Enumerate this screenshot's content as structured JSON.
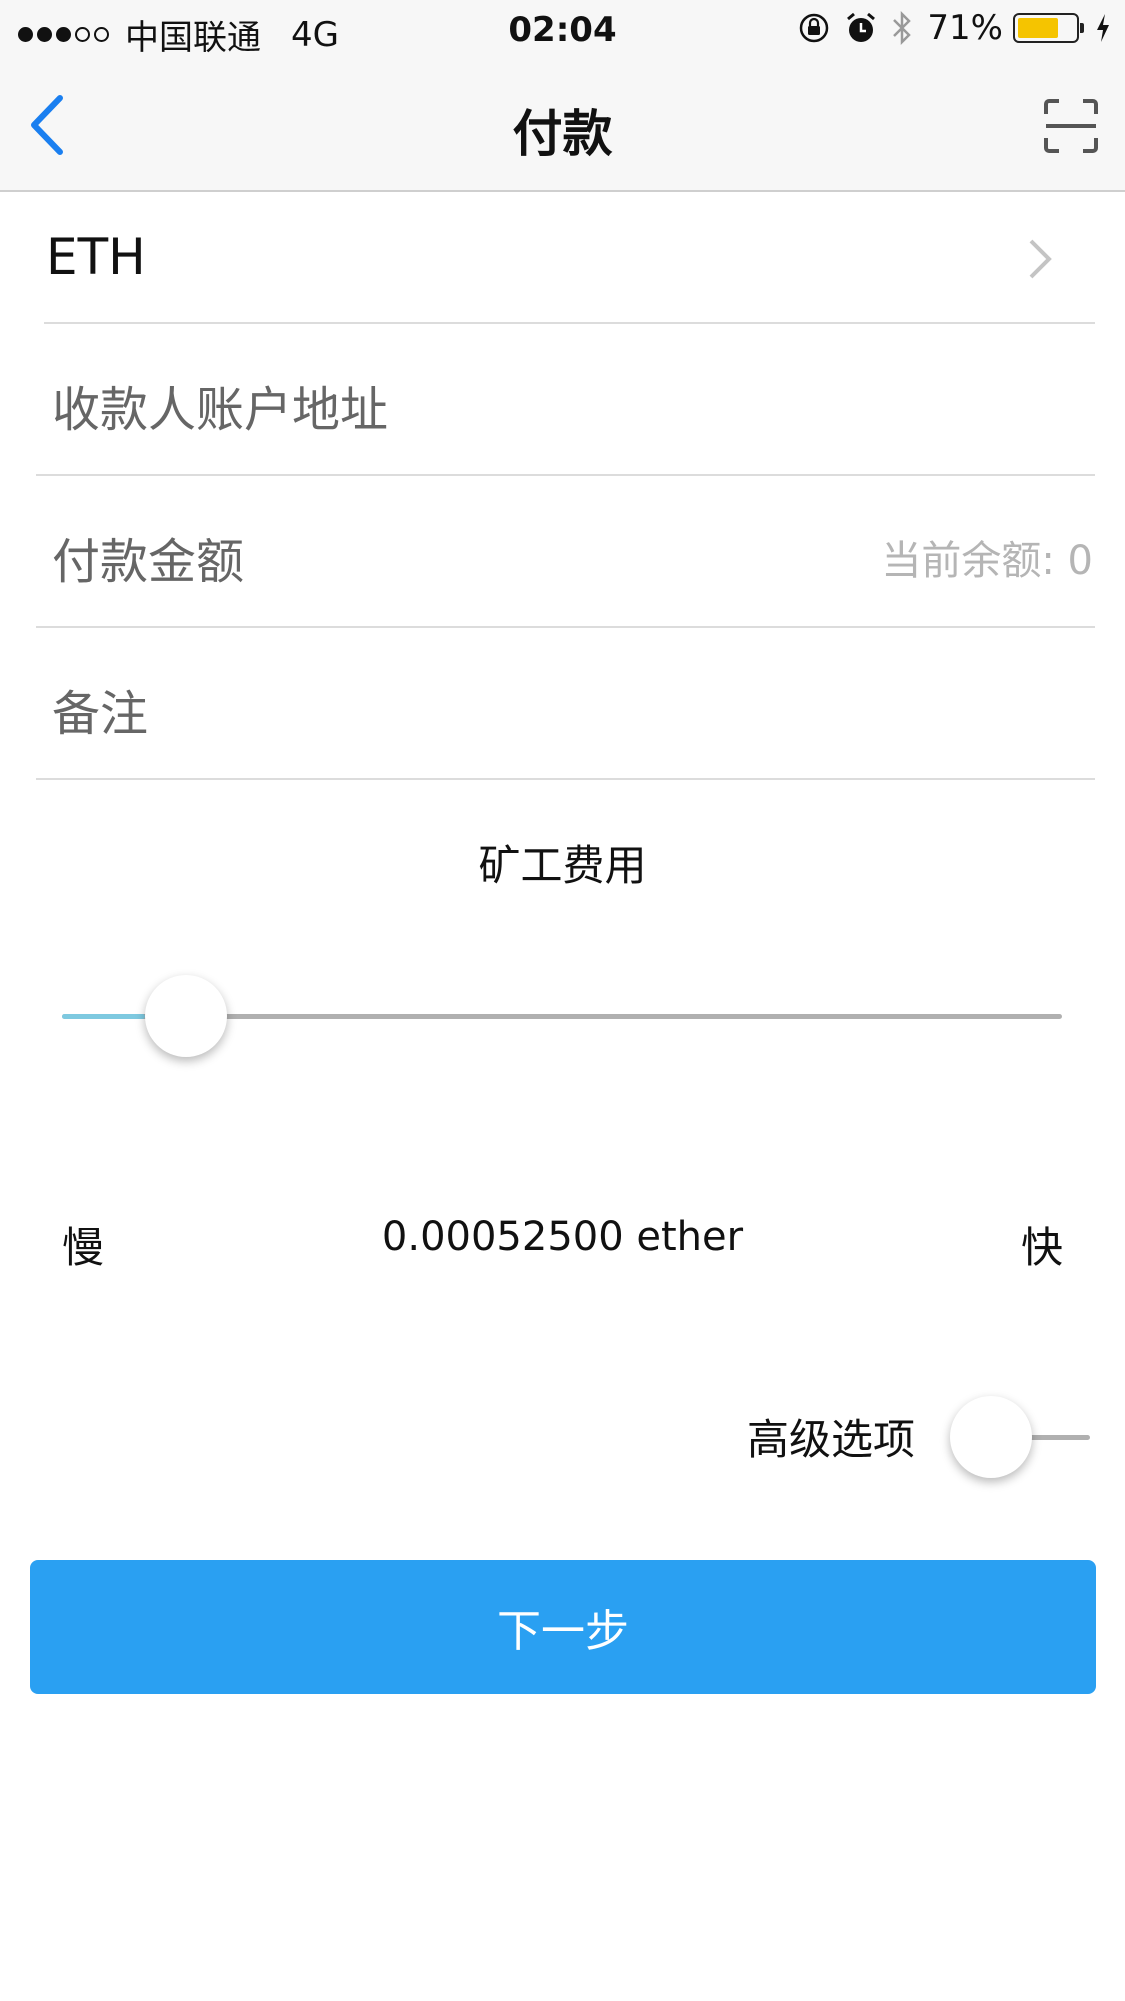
{
  "status_bar": {
    "carrier": "中国联通",
    "network": "4G",
    "time": "02:04",
    "battery": "71%",
    "battery_level": 0.71,
    "signal_bars": 3,
    "signal_total": 5,
    "battery_color": "#f5c400"
  },
  "nav": {
    "title": "付款",
    "back_icon": "chevron-left-icon",
    "scan_icon": "scan-icon",
    "accent_color": "#1a7ff0"
  },
  "form": {
    "coin": "ETH",
    "recipient_placeholder": "收款人账户地址",
    "amount_placeholder": "付款金额",
    "balance_label": "当前余额: 0",
    "memo_placeholder": "备注"
  },
  "fee": {
    "title": "矿工费用",
    "slider_level": 0.124,
    "slow_label": "慢",
    "value": "0.00052500 ether",
    "fast_label": "快"
  },
  "advanced": {
    "label": "高级选项",
    "enabled": false
  },
  "actions": {
    "next_label": "下一步",
    "button_color": "#2aa0f2"
  }
}
